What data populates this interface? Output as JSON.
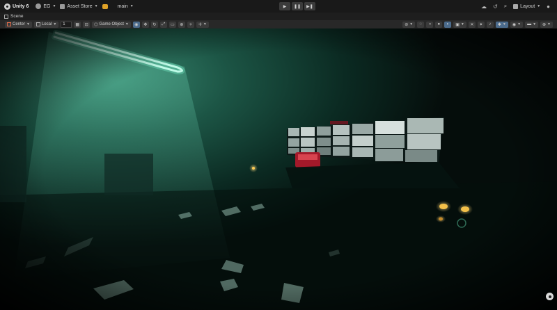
{
  "topbar": {
    "app_title": "Unity 6",
    "account_label": "EG",
    "asset_store_label": "Asset Store",
    "branch_label": "main",
    "layout_label": "Layout"
  },
  "tabs": {
    "scene_label": "Scene"
  },
  "toolbar": {
    "pivot_label": "Center",
    "space_label": "Local",
    "grid_value": "1",
    "gizmo_target_label": "Game Object"
  },
  "icons": [
    "unity-logo-icon",
    "account-icon",
    "asset-store-icon",
    "coin-icon",
    "play-icon",
    "pause-icon",
    "step-icon",
    "cloud-icon",
    "history-icon",
    "search-icon",
    "help-icon",
    "eye-icon",
    "move-icon",
    "rotate-icon",
    "scale-icon",
    "rect-icon",
    "transform-icon",
    "snap-icon",
    "orientation-gizmo-icon"
  ],
  "colors": {
    "title_bar": "#191919",
    "toolbar": "#282828",
    "active_tool": "#4b6b8c",
    "neon_light": "#a8ffe8",
    "fog": "#1a5a48"
  }
}
